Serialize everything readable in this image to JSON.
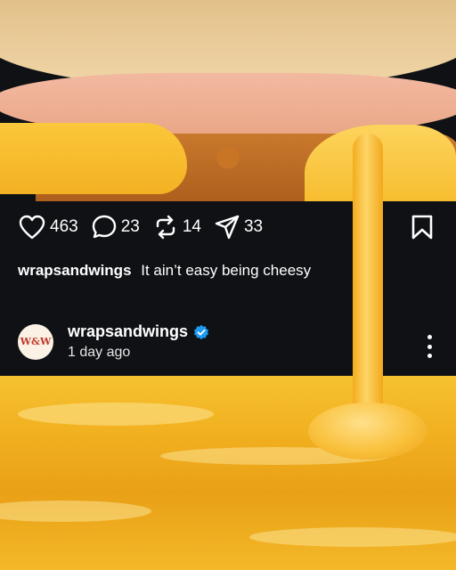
{
  "post": {
    "stats": {
      "likes": "463",
      "comments": "23",
      "reposts": "14",
      "shares": "33"
    },
    "caption": {
      "username": "wrapsandwings",
      "text": "It ain’t easy being cheesy"
    },
    "author": {
      "avatar_text": "W&W",
      "name": "wrapsandwings",
      "verified": true,
      "timestamp": "1 day ago"
    }
  },
  "icons": {
    "like": "heart-icon",
    "comment": "comment-icon",
    "repost": "repost-icon",
    "share": "send-icon",
    "save": "bookmark-icon",
    "verified": "verified-badge-icon",
    "menu": "more-options-icon"
  },
  "colors": {
    "card_background": "#0f1115",
    "verified_blue": "#1d9bf0",
    "cheese": "#f7bc2e"
  }
}
